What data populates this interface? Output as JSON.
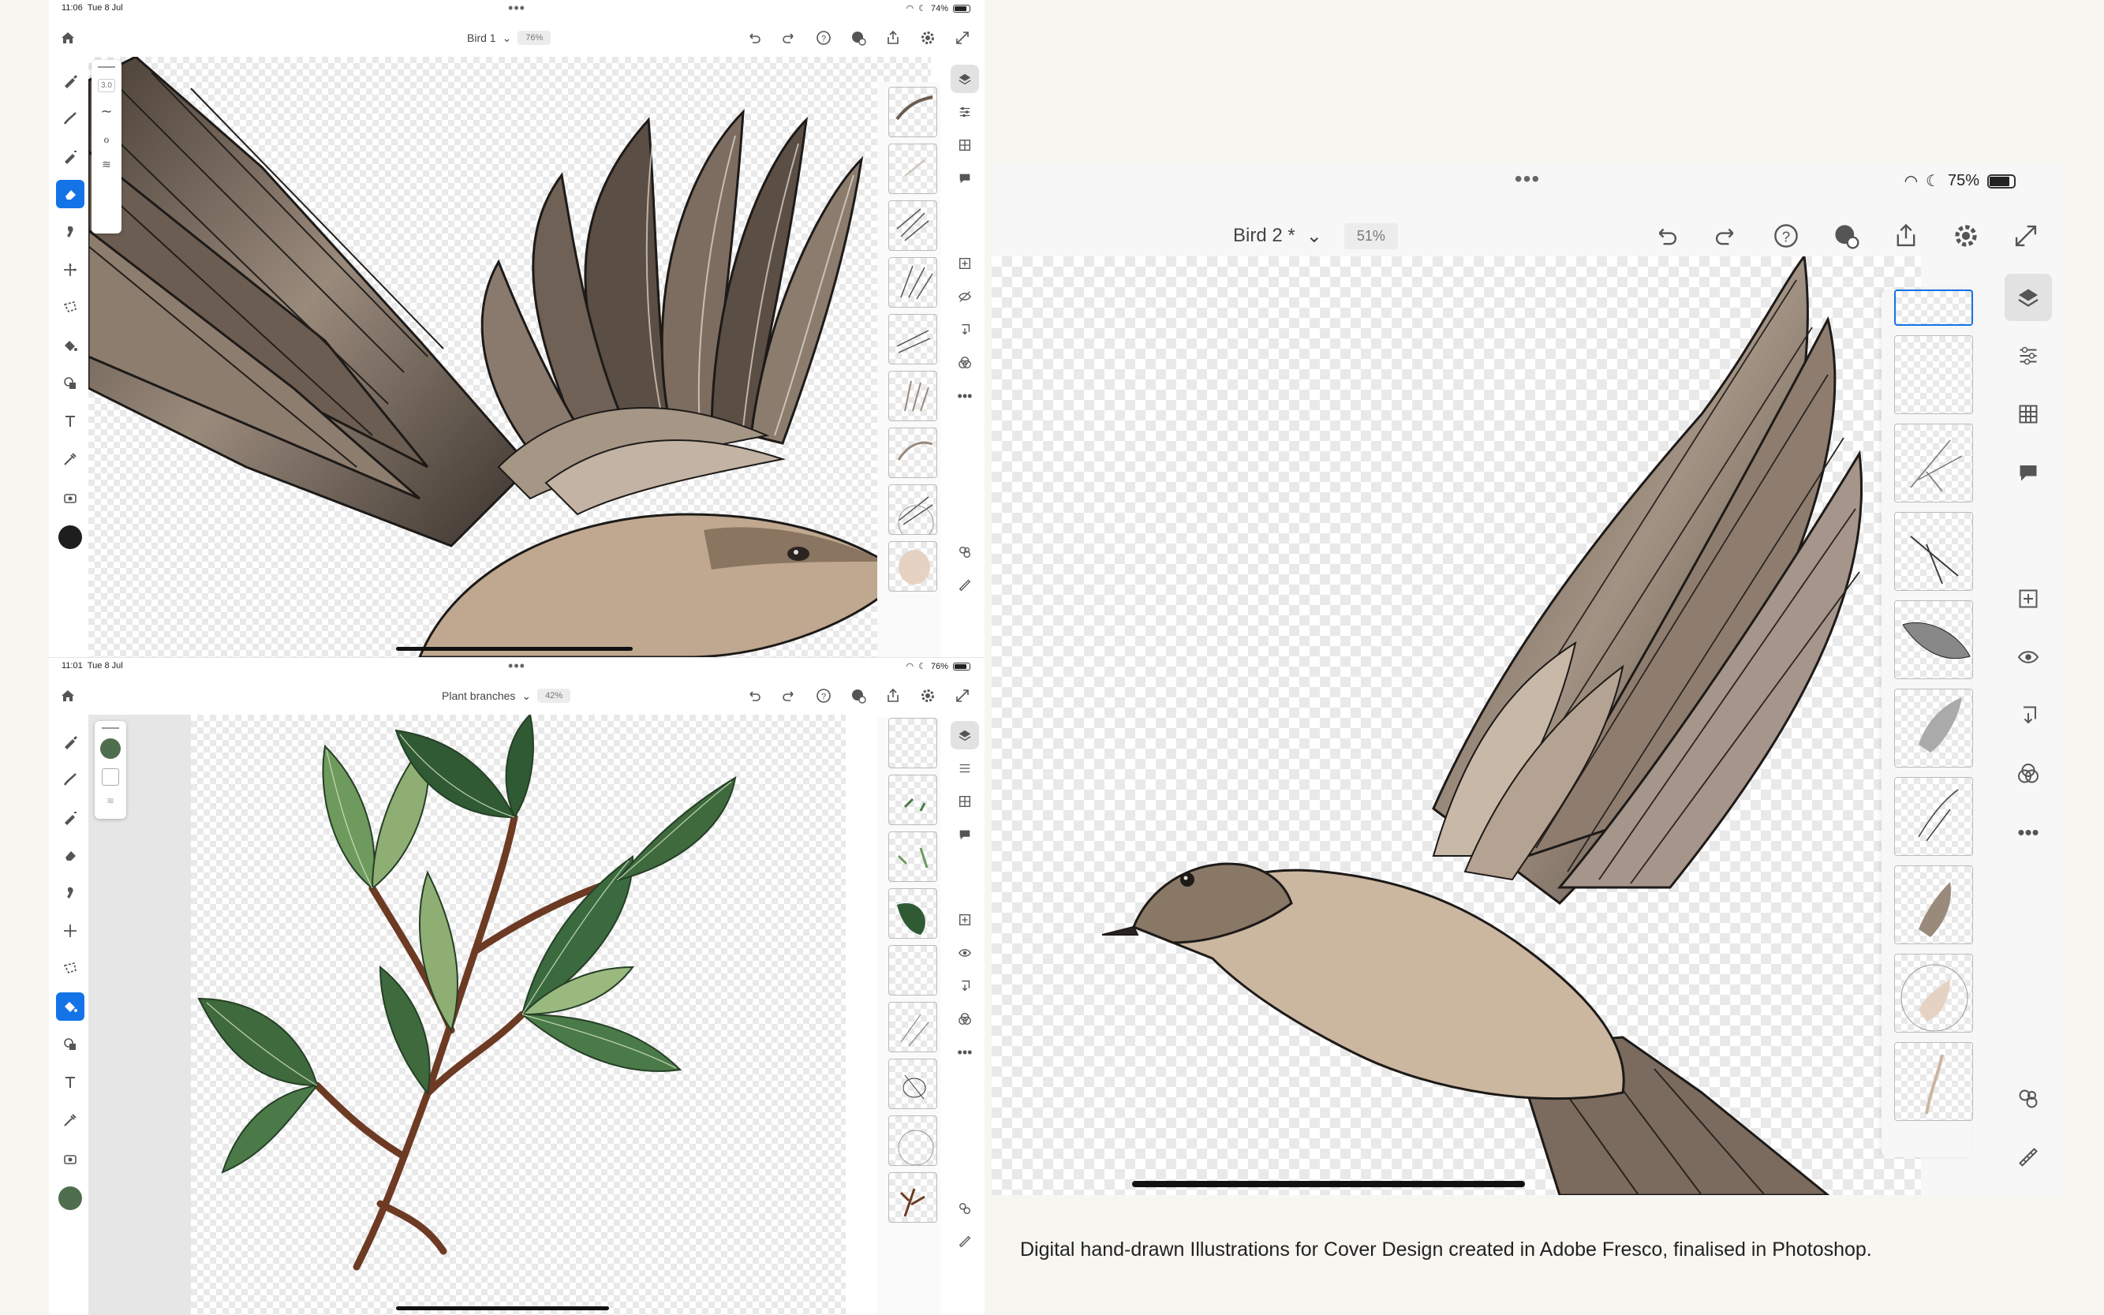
{
  "screen1": {
    "status_time": "11:06",
    "status_date": "Tue 8 Jul",
    "battery": "74%",
    "title": "Bird 1",
    "zoom": "76%",
    "brush_size": "3.0"
  },
  "screen2": {
    "status_time": "11:01",
    "status_date": "Tue 8 Jul",
    "battery": "76%",
    "title": "Plant branches",
    "zoom": "42%"
  },
  "screen3": {
    "battery": "75%",
    "title": "Bird 2 *",
    "zoom": "51%"
  },
  "caption": "Digital hand-drawn Illustrations for Cover Design created in Adobe Fresco, finalised in Photoshop.",
  "colors": {
    "accent": "#1473e6",
    "swatch_black": "#1e1e1e",
    "swatch_green": "#4f6e4e",
    "page_bg": "#f8f6f0"
  },
  "icons": {
    "left_tools": [
      "pixel-brush-icon",
      "live-brush-icon",
      "vector-brush-icon",
      "eraser-icon",
      "smudge-icon",
      "transform-icon",
      "selection-icon",
      "fill-icon",
      "shapes-icon",
      "text-icon",
      "eyedropper-icon",
      "place-image-icon"
    ],
    "top_actions": [
      "undo-icon",
      "redo-icon",
      "help-icon",
      "invite-icon",
      "share-icon",
      "settings-icon",
      "fullscreen-icon"
    ],
    "right_rail": [
      "layers-icon",
      "layer-properties-icon",
      "grid-icon",
      "comment-icon",
      "add-layer-icon",
      "visibility-icon",
      "merge-down-icon",
      "blend-mode-icon",
      "more-icon",
      "shapes-overlay-icon",
      "ruler-icon"
    ]
  }
}
